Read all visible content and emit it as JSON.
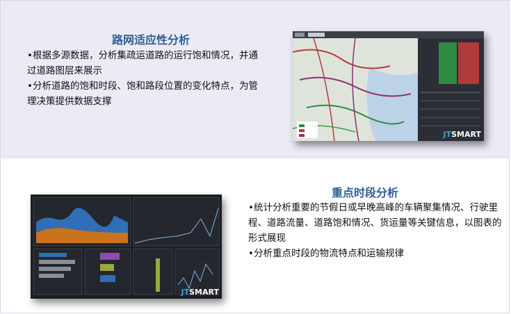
{
  "section1": {
    "title": "路网适应性分析",
    "bullets": [
      "•根据多源数据，分析集疏运道路的运行饱和情况，并通过道路图层来展示",
      "•分析道路的饱和时段、饱和路段位置的变化特点，为管理决策提供数据支撑"
    ],
    "screenshot_brand_prefix": "JT",
    "screenshot_brand": "SMART"
  },
  "section2": {
    "title": "重点时段分析",
    "bullets": [
      "•统计分析重要的节假日或早晚高峰的车辆聚集情况、行驶里程、道路流量、道路饱和情况、货运量等关键信息，以图表的形式展现",
      "•分析重点时段的物流特点和运输规律"
    ],
    "screenshot_brand_prefix": "JT",
    "screenshot_brand": "SMART"
  },
  "colors": {
    "title": "#2f5e93",
    "top_panel_bg": "#ecebf5",
    "brand_accent": "#3aa1e0"
  }
}
